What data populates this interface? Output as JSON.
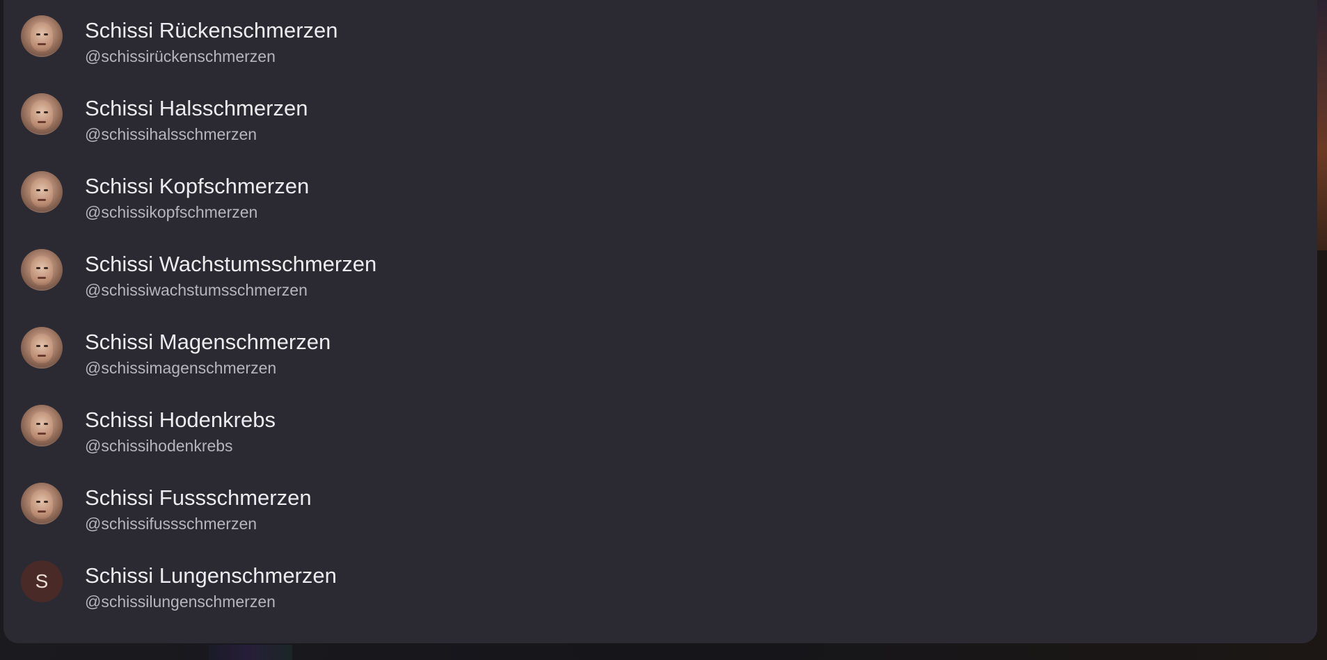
{
  "mentions": [
    {
      "name": "Schissi Rückenschmerzen",
      "handle": "@schissirückenschmerzen",
      "avatar": "photo"
    },
    {
      "name": "Schissi Halsschmerzen",
      "handle": "@schissihalsschmerzen",
      "avatar": "photo"
    },
    {
      "name": "Schissi Kopfschmerzen",
      "handle": "@schissikopfschmerzen",
      "avatar": "photo"
    },
    {
      "name": "Schissi Wachstumsschmerzen",
      "handle": "@schissiwachstumsschmerzen",
      "avatar": "photo"
    },
    {
      "name": "Schissi Magenschmerzen",
      "handle": "@schissimagenschmerzen",
      "avatar": "photo"
    },
    {
      "name": "Schissi Hodenkrebs",
      "handle": "@schissihodenkrebs",
      "avatar": "photo"
    },
    {
      "name": "Schissi Fussschmerzen",
      "handle": "@schissifussschmerzen",
      "avatar": "photo"
    },
    {
      "name": "Schissi Lungenschmerzen",
      "handle": "@schissilungenschmerzen",
      "avatar": "letter",
      "initial": "S"
    }
  ]
}
